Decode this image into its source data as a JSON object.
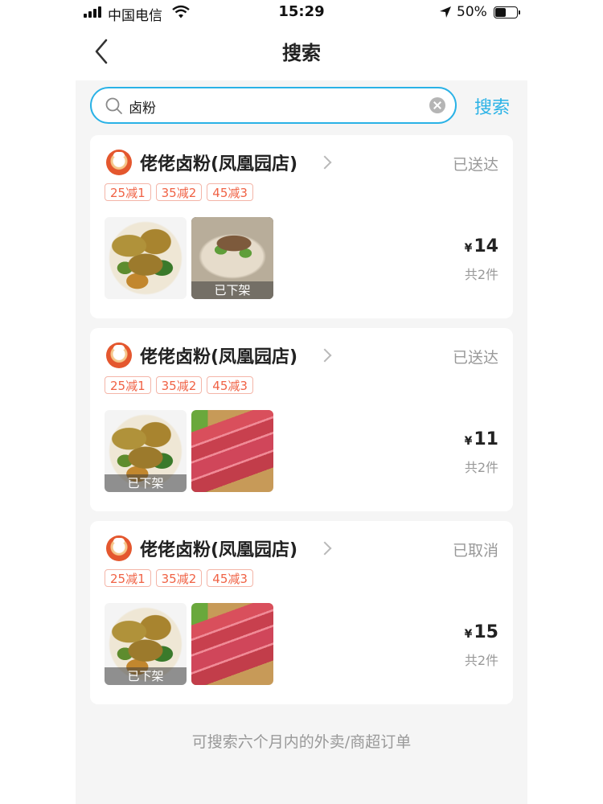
{
  "status_bar": {
    "carrier": "中国电信",
    "time": "15:29",
    "battery": "50%"
  },
  "nav": {
    "title": "搜索"
  },
  "search": {
    "value": "卤粉",
    "button_label": "搜索"
  },
  "orders": [
    {
      "shop": "佬佬卤粉(凤凰园店)",
      "status": "已送达",
      "tags": [
        "25减1",
        "35减2",
        "45减3"
      ],
      "items": [
        {
          "image": "braised-meat-plate",
          "badge": ""
        },
        {
          "image": "noodle-bowl",
          "badge": "已下架"
        }
      ],
      "price_symbol": "¥",
      "price": "14",
      "count": "共2件"
    },
    {
      "shop": "佬佬卤粉(凤凰园店)",
      "status": "已送达",
      "tags": [
        "25减1",
        "35减2",
        "45减3"
      ],
      "items": [
        {
          "image": "braised-meat-plate",
          "badge": "已下架"
        },
        {
          "image": "sausage",
          "badge": ""
        }
      ],
      "price_symbol": "¥",
      "price": "11",
      "count": "共2件"
    },
    {
      "shop": "佬佬卤粉(凤凰园店)",
      "status": "已取消",
      "tags": [
        "25减1",
        "35减2",
        "45减3"
      ],
      "items": [
        {
          "image": "braised-meat-plate",
          "badge": "已下架"
        },
        {
          "image": "sausage",
          "badge": ""
        }
      ],
      "price_symbol": "¥",
      "price": "15",
      "count": "共2件"
    }
  ],
  "footer_note": "可搜索六个月内的外卖/商超订单",
  "colors": {
    "accent": "#2ab2e6",
    "tag": "#f06245",
    "muted": "#999999"
  }
}
